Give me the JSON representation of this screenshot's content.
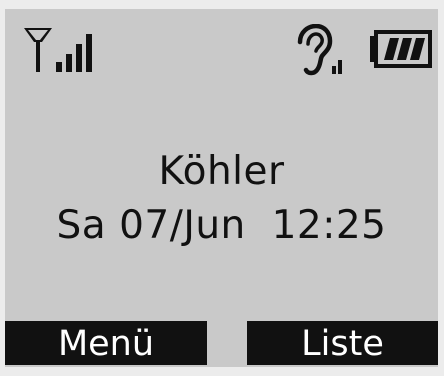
{
  "status_bar": {
    "signal_icon": "signal-strength-icon",
    "hearing_icon": "hearing-aid-mode-icon",
    "battery_icon": "battery-full-icon",
    "battery_level": 1.0
  },
  "display": {
    "name": "Köhler",
    "datetime": "Sa 07/Jun  12:25"
  },
  "softkeys": {
    "left_label": "Menü",
    "right_label": "Liste"
  },
  "colors": {
    "screen_background": "#c9c9c9",
    "foreground": "#111111",
    "softkey_background": "#111111",
    "softkey_text": "#ffffff"
  }
}
